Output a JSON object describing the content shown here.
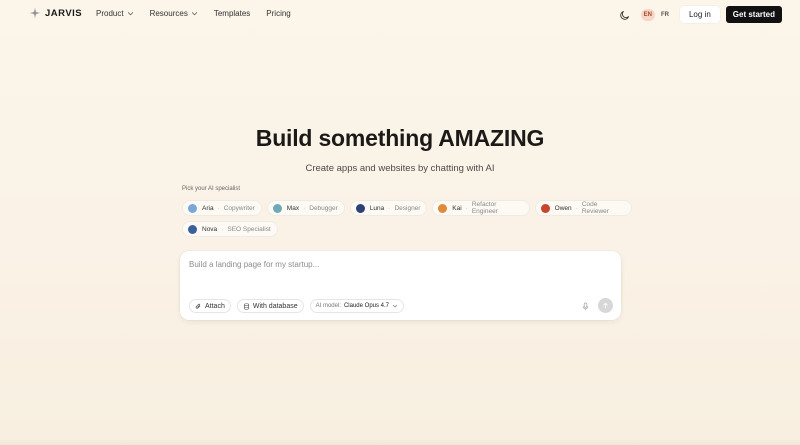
{
  "brand": {
    "name": "JARVIS"
  },
  "nav": {
    "menu": [
      {
        "label": "Product",
        "has_dropdown": true
      },
      {
        "label": "Resources",
        "has_dropdown": true
      },
      {
        "label": "Templates",
        "has_dropdown": false
      },
      {
        "label": "Pricing",
        "has_dropdown": false
      }
    ],
    "theme_icon": "moon-icon",
    "languages": [
      {
        "code": "EN",
        "active": true
      },
      {
        "code": "FR",
        "active": false
      }
    ],
    "login_label": "Log in",
    "cta_label": "Get started"
  },
  "hero": {
    "title": "Build something AMAZING",
    "subtitle": "Create apps and websites by chatting with AI"
  },
  "specialists": {
    "label": "Pick your AI specialist",
    "rows": [
      [
        {
          "name": "Aria",
          "role": "Copywriter",
          "color": "#7aa7d6"
        },
        {
          "name": "Max",
          "role": "Debugger",
          "color": "#6fa8b8"
        },
        {
          "name": "Luna",
          "role": "Designer",
          "color": "#2f3f7a"
        },
        {
          "name": "Kai",
          "role": "Refactor Engineer",
          "color": "#e08a3a"
        },
        {
          "name": "Owen",
          "role": "Code Reviewer",
          "color": "#c8452f"
        }
      ],
      [
        {
          "name": "Nova",
          "role": "SEO Specialist",
          "color": "#3b5f9a"
        }
      ]
    ]
  },
  "prompt": {
    "placeholder": "Build a landing page for my startup...",
    "value": "",
    "attach_label": "Attach",
    "database_label": "With database",
    "model_label": "AI model:",
    "model_value": "Claude Opus 4.7",
    "mic_icon": "microphone-icon",
    "send_icon": "arrow-up-icon"
  }
}
